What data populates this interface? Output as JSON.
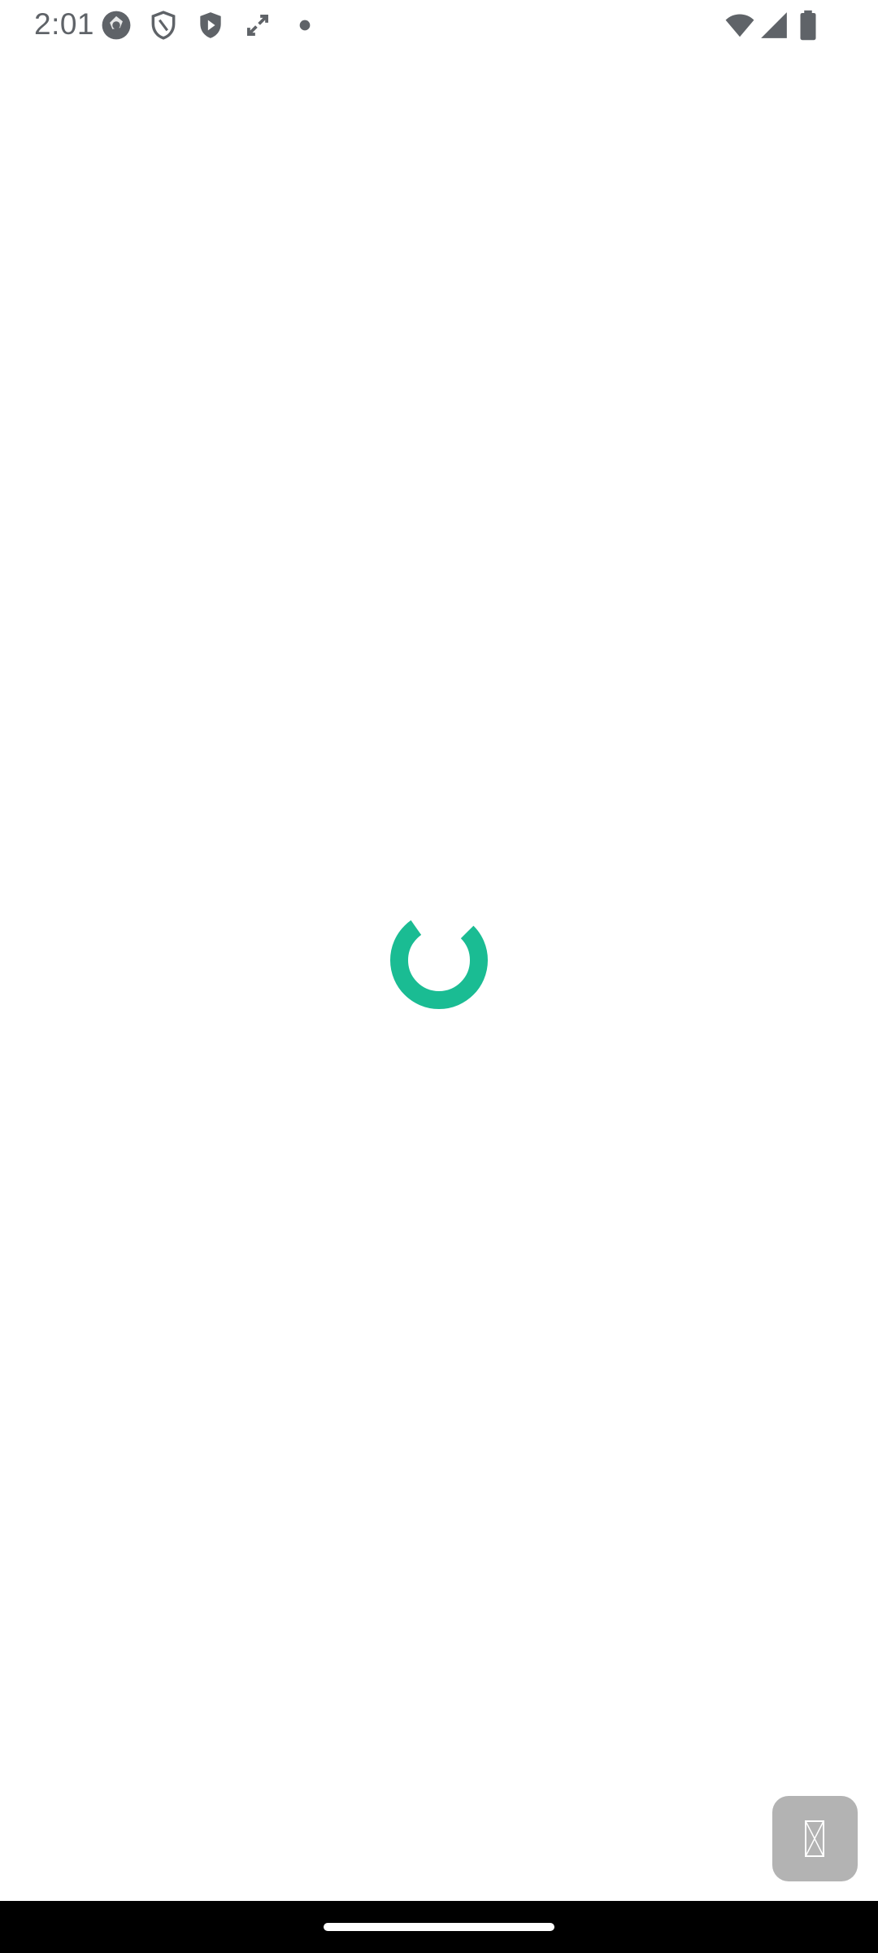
{
  "status_bar": {
    "time": "2:01",
    "left_icons": [
      "camera-shutter-icon",
      "shield-outline-icon",
      "shield-play-icon",
      "expand-arrows-icon",
      "dot-icon"
    ],
    "right_icons": [
      "wifi-icon",
      "cell-signal-icon",
      "battery-icon"
    ],
    "icon_color": "#5f6368"
  },
  "main": {
    "loader": {
      "state": "loading",
      "color": "#1abc93"
    },
    "floating_button": {
      "icon": "missing-image-icon",
      "background": "#b3b3b3"
    }
  },
  "navigation_bar": {
    "background": "#000000",
    "handle": "home-handle"
  }
}
